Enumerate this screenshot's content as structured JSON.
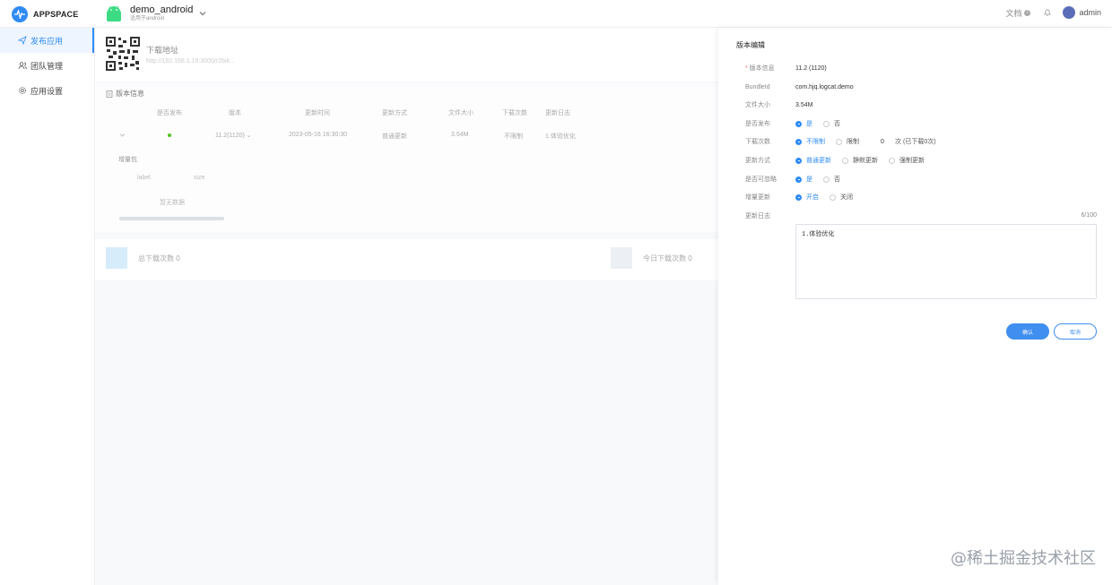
{
  "brand": {
    "name": "APPSPACE",
    "accent": "#2f8bf5"
  },
  "app": {
    "name": "demo_android",
    "subtitle": "适用于android"
  },
  "topbar": {
    "docs_label": "文档",
    "user_name": "admin"
  },
  "sidebar": {
    "items": [
      {
        "label": "发布应用",
        "icon": "send-icon",
        "active": true
      },
      {
        "label": "团队管理",
        "icon": "team-icon",
        "active": false
      },
      {
        "label": "应用设置",
        "icon": "gear-icon",
        "active": false
      }
    ]
  },
  "download": {
    "title": "下载地址",
    "url": "http://192.168.1.19:3000/r2bik..."
  },
  "versions": {
    "heading": "版本信息",
    "columns": [
      "是否发布",
      "版本",
      "更新时间",
      "更新方式",
      "文件大小",
      "下载次数",
      "更新日志"
    ],
    "rows": [
      {
        "version": "11.2(1120)",
        "updated": "2023-05-16 16:30:30",
        "mode": "普通更新",
        "size": "3.54M",
        "downloads": "不限制",
        "log": "1.体验优化"
      }
    ],
    "sub_title": "增量包",
    "sub_columns": [
      "label",
      "size"
    ],
    "empty": "暂无数据"
  },
  "stats": {
    "total": "总下载次数 0",
    "today": "今日下载次数 0"
  },
  "drawer": {
    "title": "版本编辑",
    "fields": {
      "version_label": "版本信息",
      "version_value": "11.2 (1120)",
      "bundle_label": "BundleId",
      "bundle_value": "com.hjq.logcat.demo",
      "size_label": "文件大小",
      "size_value": "3.54M",
      "publish_label": "是否发布",
      "publish_yes": "是",
      "publish_no": "否",
      "downloads_label": "下载次数",
      "downloads_unlimited": "不限制",
      "downloads_limit": "限制",
      "downloads_value": "0",
      "downloads_unit": "次",
      "downloads_note": "(已下载0次)",
      "mode_label": "更新方式",
      "mode_normal": "普通更新",
      "mode_silent": "静默更新",
      "mode_force": "强制更新",
      "ignore_label": "是否可忽略",
      "ignore_yes": "是",
      "ignore_no": "否",
      "delta_label": "增量更新",
      "delta_on": "开启",
      "delta_off": "关闭",
      "log_label": "更新日志",
      "log_value": "1.体验优化",
      "log_counter": "6/100"
    },
    "confirm": "确认",
    "cancel": "取消"
  },
  "watermark": "@稀土掘金技术社区"
}
